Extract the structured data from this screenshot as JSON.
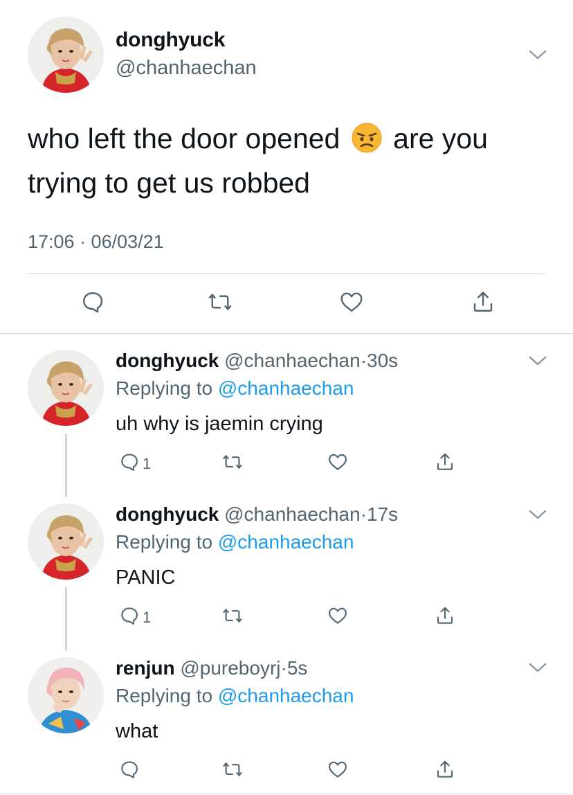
{
  "main_tweet": {
    "display_name": "donghyuck",
    "handle": "@chanhaechan",
    "text": "who left the door opened",
    "emoji": "angry-face",
    "text_after_emoji": "are you trying to get us robbed",
    "timestamp": "17:06 · 06/03/21",
    "actions": [
      "reply-icon",
      "retweet-icon",
      "like-icon",
      "share-icon"
    ]
  },
  "replies": [
    {
      "display_name": "donghyuck",
      "handle": "@chanhaechan",
      "dot": "·",
      "time": "30s",
      "replying_prefix": "Replying to",
      "replying_to": "@chanhaechan",
      "text": "uh why is jaemin crying",
      "reply_count": "1"
    },
    {
      "display_name": "donghyuck",
      "handle": "@chanhaechan",
      "dot": "·",
      "time": "17s",
      "replying_prefix": "Replying to",
      "replying_to": "@chanhaechan",
      "text": "PANIC",
      "reply_count": "1"
    },
    {
      "display_name": "renjun",
      "handle": "@pureboyrj",
      "dot": "·",
      "time": "5s",
      "replying_prefix": "Replying to",
      "replying_to": "@chanhaechan",
      "text": "what",
      "reply_count": ""
    }
  ],
  "colors": {
    "text": "#0f1419",
    "secondary": "#536471",
    "link": "#1d9bf0",
    "divider": "#cfd9de",
    "icon": "#536471"
  }
}
